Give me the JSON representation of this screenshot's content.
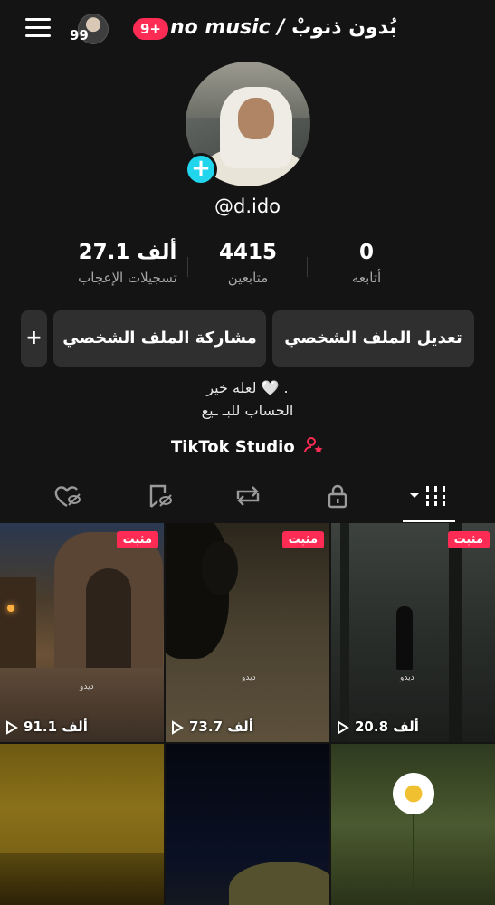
{
  "header": {
    "avatar_count": "99",
    "notification_badge": "9+",
    "title_en": "no music /",
    "title_ar": "بُدون ذنوبْ"
  },
  "profile": {
    "username": "@d.ido"
  },
  "stats": {
    "likes": {
      "value": "27.1 ألف",
      "label": "تسجيلات الإعجاب"
    },
    "followers": {
      "value": "4415",
      "label": "متابعين"
    },
    "following": {
      "value": "0",
      "label": "أتابعه"
    }
  },
  "buttons": {
    "edit_profile": "تعديل الملف الشخصي",
    "share_profile": "مشاركة الملف الشخصي",
    "add_friend": "+"
  },
  "bio": {
    "line1": "لعله خير 🤍 .",
    "line2": "الحساب للبـ ـيع"
  },
  "studio": {
    "label": "TikTok Studio"
  },
  "tabs": [
    {
      "name": "liked",
      "icon": "heart-eye-off-icon"
    },
    {
      "name": "favorites",
      "icon": "bookmark-eye-off-icon"
    },
    {
      "name": "reposts",
      "icon": "repost-icon"
    },
    {
      "name": "private",
      "icon": "lock-icon"
    },
    {
      "name": "videos",
      "icon": "grid-icon",
      "active": true
    }
  ],
  "videos": [
    {
      "pinned": "مثبت",
      "views": "91.1 ألف",
      "watermark": "ديدو"
    },
    {
      "pinned": "مثبت",
      "views": "73.7 ألف",
      "watermark": "ديدو"
    },
    {
      "pinned": "مثبت",
      "views": "20.8 ألف",
      "watermark": "ديدو"
    },
    {
      "pinned": "",
      "views": "",
      "watermark": ""
    },
    {
      "pinned": "",
      "views": "",
      "watermark": ""
    },
    {
      "pinned": "",
      "views": "",
      "watermark": ""
    }
  ],
  "colors": {
    "accent": "#fe2c55",
    "avatar_add": "#20d5ec",
    "background": "#141414",
    "button": "#2f2f2f"
  }
}
